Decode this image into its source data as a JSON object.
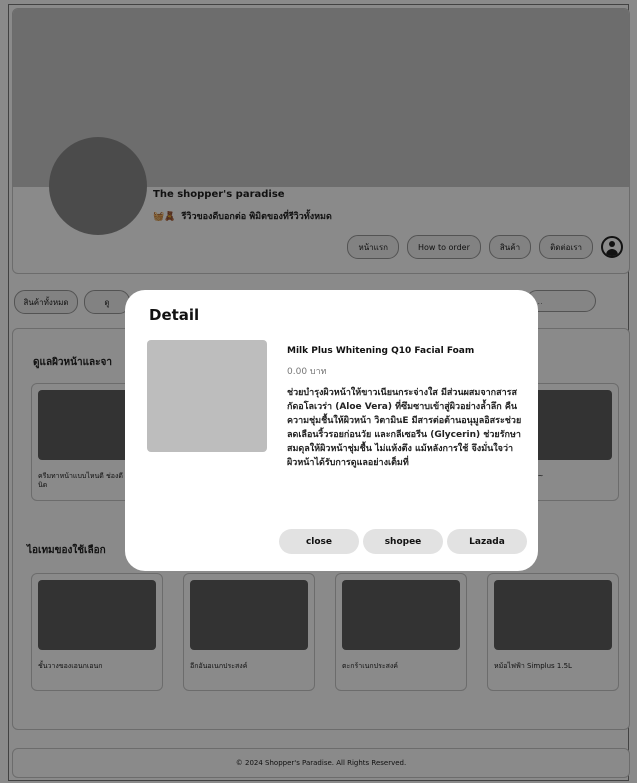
{
  "header": {
    "shop_name": "The shopper's paradise",
    "tag_emoji": "🧺🧸",
    "tagline": "รีวิวของดีบอกต่อ พิมิตของที่รีวิวทั้งหมด"
  },
  "nav": {
    "items": [
      "หน้าแรก",
      "How to order",
      "สินค้า",
      "ติดต่อเรา"
    ],
    "user_icon": "user-circle-icon"
  },
  "filters": {
    "chips": [
      "สินค้าทั้งหมด",
      "ดู"
    ],
    "search_placeholder": "..."
  },
  "sections": [
    {
      "title": "ดูแลผิวหน้าและจา",
      "products": [
        {
          "name": "ครีมทาหน้าแบบไหนดี ช่องดี ตลาดนัดนิด"
        },
        {
          "name": ""
        },
        {
          "name": ""
        },
        {
          "name": "TINT OIL ~~~"
        }
      ]
    },
    {
      "title": "ไอเทมของใช้เลือก",
      "products": [
        {
          "name": "ชั้นวางของเอนกเอนก"
        },
        {
          "name": "อีกอันอเนกประสงค์"
        },
        {
          "name": "ตะกร้าเนกประสงค์"
        },
        {
          "name": "หม้อไฟฟ้า Simplus 1.5L"
        }
      ]
    }
  ],
  "footer": {
    "text": "© 2024 Shopper's Paradise. All Rights Reserved."
  },
  "modal": {
    "title": "Detail",
    "product_name": "Milk Plus Whitening Q10 Facial Foam",
    "price": "0.00 บาท",
    "description": "ช่วยบำรุงผิวหน้าให้ขาวเนียนกระจ่างใส มีส่วนผสมจากสารสกัดอโลเวร่า (Aloe Vera) ที่ซึมซาบเข้าสู่ผิวอย่างล้ำลึก คืนความชุ่มชื้นให้ผิวหน้า วิตามินE มีสารต่อต้านอนุมูลอิสระช่วยลดเลือนริ้วรอยก่อนวัย และกลีเซอรีน (Glycerin) ช่วยรักษาสมดุลให้ผิวหน้าชุ่มชื้น ไม่แห้งตึง แม้หลังการใช้ จึงมั่นใจว่า ผิวหน้าได้รับการดูแลอย่างเต็มที่",
    "buttons": {
      "close": "close",
      "shopee": "shopee",
      "lazada": "Lazada"
    }
  },
  "colors": {
    "overlay": "#000000",
    "card_image": "#5e5e5e",
    "modal_image": "#bdbdbd",
    "button_bg": "#e2e2e2"
  }
}
